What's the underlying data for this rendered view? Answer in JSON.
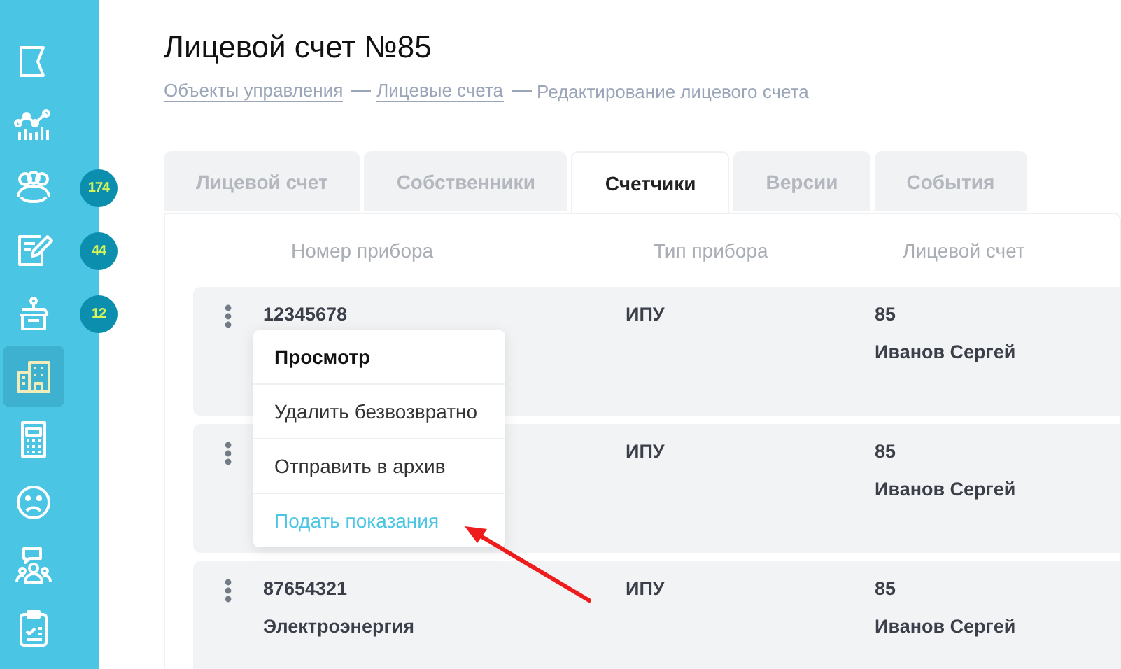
{
  "sidebar": {
    "items": [
      {
        "selected": false
      },
      {
        "selected": false
      },
      {
        "selected": false,
        "badge": "174"
      },
      {
        "selected": false,
        "badge": "44"
      },
      {
        "selected": false,
        "badge": "12"
      },
      {
        "selected": true
      },
      {
        "selected": false
      },
      {
        "selected": false
      },
      {
        "selected": false
      },
      {
        "selected": false
      }
    ]
  },
  "title": "Лицевой счет №85",
  "breadcrumbs": [
    {
      "label": "Объекты управления",
      "link": true
    },
    {
      "label": "Лицевые счета",
      "link": true
    },
    {
      "label": "Редактирование лицевого счета",
      "link": false
    }
  ],
  "tabs": [
    {
      "label": "Лицевой счет",
      "selected": false
    },
    {
      "label": "Собственники",
      "selected": false
    },
    {
      "label": "Счетчики",
      "selected": true
    },
    {
      "label": "Версии",
      "selected": false
    },
    {
      "label": "События",
      "selected": false
    }
  ],
  "table": {
    "columns": [
      "Номер прибора",
      "Тип прибора",
      "Лицевой счет"
    ],
    "rows": [
      {
        "number": "12345678",
        "type": "ИПУ",
        "account": "85",
        "owner": "Иванов Сергей"
      },
      {
        "type": "ИПУ",
        "account": "85",
        "owner": "Иванов Сергей"
      },
      {
        "number": "87654321",
        "resource": "Электроэнергия",
        "type": "ИПУ",
        "account": "85",
        "owner": "Иванов Сергей"
      }
    ]
  },
  "context_menu": {
    "items": [
      {
        "label": "Просмотр",
        "kind": "bold"
      },
      {
        "label": "Удалить безвозвратно",
        "kind": "normal"
      },
      {
        "label": "Отправить в архив",
        "kind": "normal"
      },
      {
        "label": "Подать показания",
        "kind": "accent"
      }
    ]
  },
  "annotation": {
    "kind": "arrow"
  }
}
